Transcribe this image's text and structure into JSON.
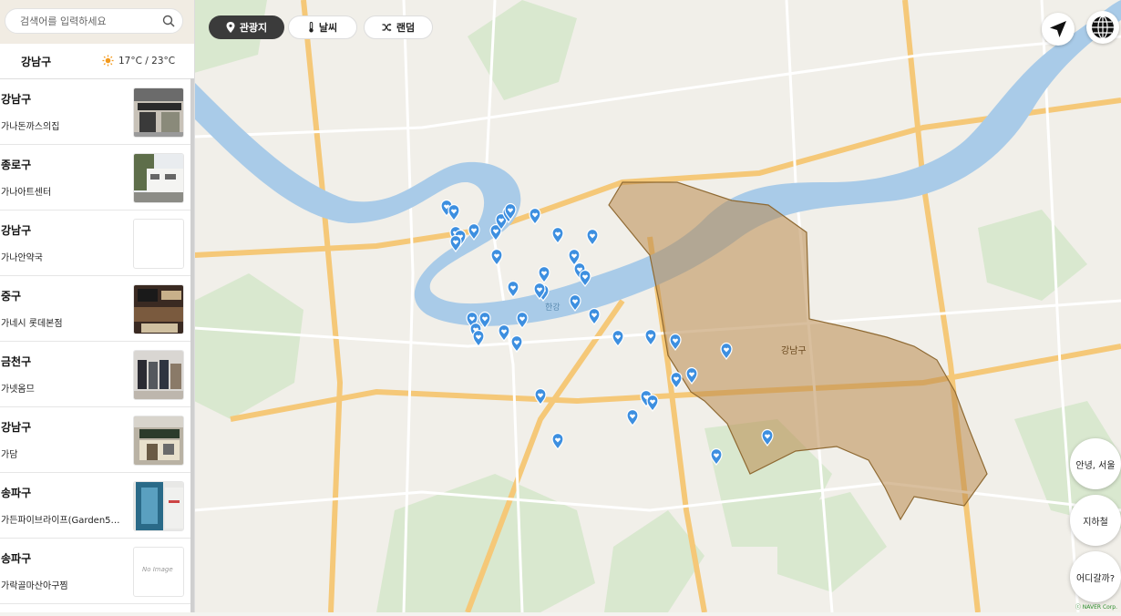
{
  "search": {
    "placeholder": "검색어를 입력하세요"
  },
  "weather": {
    "district": "강남구",
    "temp": "17°C / 23°C"
  },
  "list": [
    {
      "district": "강남구",
      "name": "가나돈까스의집",
      "thumb": "shop-front"
    },
    {
      "district": "종로구",
      "name": "가나아트센터",
      "thumb": "building"
    },
    {
      "district": "강남구",
      "name": "가나안약국",
      "thumb": "blank"
    },
    {
      "district": "중구",
      "name": "가네시 롯데본점",
      "thumb": "store-interior"
    },
    {
      "district": "금천구",
      "name": "가넷옴므",
      "thumb": "clothing"
    },
    {
      "district": "강남구",
      "name": "가담",
      "thumb": "restaurant"
    },
    {
      "district": "송파구",
      "name": "가든파이브라이프(Garden5…",
      "thumb": "glass-building"
    },
    {
      "district": "송파구",
      "name": "가락골마산아구찜",
      "thumb": "no-image"
    }
  ],
  "no_image_text": "No Image",
  "top_buttons": [
    {
      "label": "관광지",
      "icon": "pin-icon",
      "active": true
    },
    {
      "label": "날씨",
      "icon": "thermometer-icon",
      "active": false
    },
    {
      "label": "랜덤",
      "icon": "shuffle-icon",
      "active": false
    }
  ],
  "side_buttons": {
    "greeting": "안녕, 서울",
    "subway": "지하철",
    "where": "어디갈까?"
  },
  "map_labels": {
    "gangnam": "강남구",
    "hangang": "한강",
    "attribution": "ⓒ NAVER Corp."
  },
  "colors": {
    "accent_dark": "#3b3b3b",
    "region_fill": "#b98a4e",
    "marker": "#3d8fe0",
    "river": "#a9cbe8"
  }
}
